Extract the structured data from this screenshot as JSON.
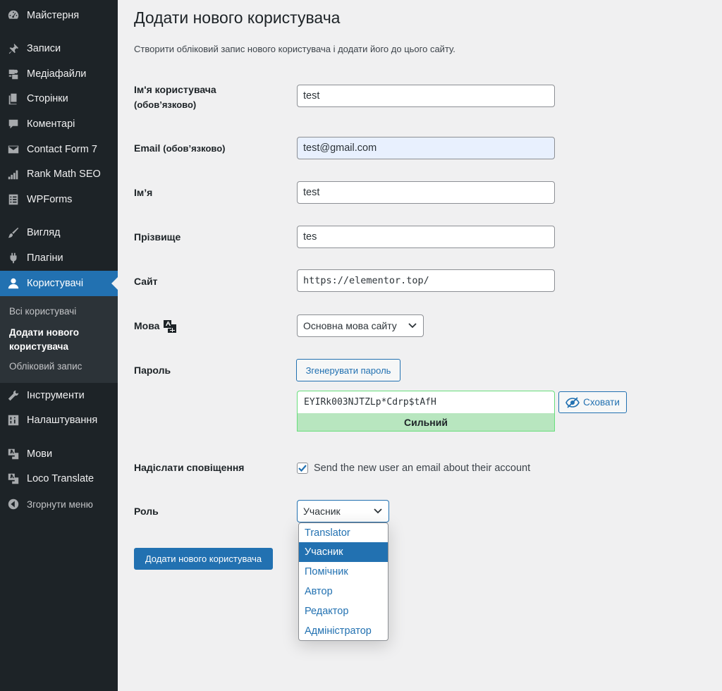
{
  "sidebar": {
    "items": [
      {
        "label": "Майстерня",
        "icon": "dashboard-icon"
      },
      {
        "label": "Записи",
        "icon": "pin-icon"
      },
      {
        "label": "Медіафайли",
        "icon": "media-icon"
      },
      {
        "label": "Сторінки",
        "icon": "page-icon"
      },
      {
        "label": "Коментарі",
        "icon": "comment-icon"
      },
      {
        "label": "Contact Form 7",
        "icon": "mail-icon"
      },
      {
        "label": "Rank Math SEO",
        "icon": "chart-icon"
      },
      {
        "label": "WPForms",
        "icon": "form-icon"
      },
      {
        "label": "Вигляд",
        "icon": "brush-icon"
      },
      {
        "label": "Плагіни",
        "icon": "plugin-icon"
      },
      {
        "label": "Користувачі",
        "icon": "user-icon"
      },
      {
        "label": "Інструменти",
        "icon": "wrench-icon"
      },
      {
        "label": "Налаштування",
        "icon": "settings-icon"
      },
      {
        "label": "Мови",
        "icon": "translate-icon"
      },
      {
        "label": "Loco Translate",
        "icon": "translate-icon"
      },
      {
        "label": "Згорнути меню",
        "icon": "collapse-icon"
      }
    ],
    "submenu": [
      {
        "label": "Всі користувачі"
      },
      {
        "label": "Додати нового користувача"
      },
      {
        "label": "Обліковий запис"
      }
    ]
  },
  "main": {
    "title": "Додати нового користувача",
    "description": "Створити обліковий запис нового користувача і додати його до цього сайту.",
    "fields": {
      "username": {
        "label": "Ім'я користувача",
        "required": "(обов’язково)",
        "value": "test"
      },
      "email": {
        "label": "Email",
        "required": "(обов’язково)",
        "value": "test@gmail.com"
      },
      "first_name": {
        "label": "Ім’я",
        "value": "test"
      },
      "last_name": {
        "label": "Прізвище",
        "value": "tes"
      },
      "website": {
        "label": "Сайт",
        "value": "https://elementor.top/"
      },
      "language": {
        "label": "Мова",
        "value": "Основна мова сайту"
      },
      "password": {
        "label": "Пароль",
        "generate_label": "Згенерувати пароль",
        "value": "EYIRk003NJTZLp*Cdrp$tAfH",
        "strength": "Сильний",
        "hide_label": "Сховати"
      },
      "notify": {
        "label": "Надіслати сповіщення",
        "checkbox_label": "Send the new user an email about their account",
        "checked": true
      },
      "role": {
        "label": "Роль",
        "value": "Учасник",
        "options": [
          "Translator",
          "Учасник",
          "Помічник",
          "Автор",
          "Редактор",
          "Адміністратор"
        ],
        "selected_index": 1
      }
    },
    "submit_label": "Додати нового користувача"
  },
  "colors": {
    "sidebar_bg": "#1d2327",
    "accent": "#2271b1",
    "strength_bg": "#b8e6bf"
  }
}
